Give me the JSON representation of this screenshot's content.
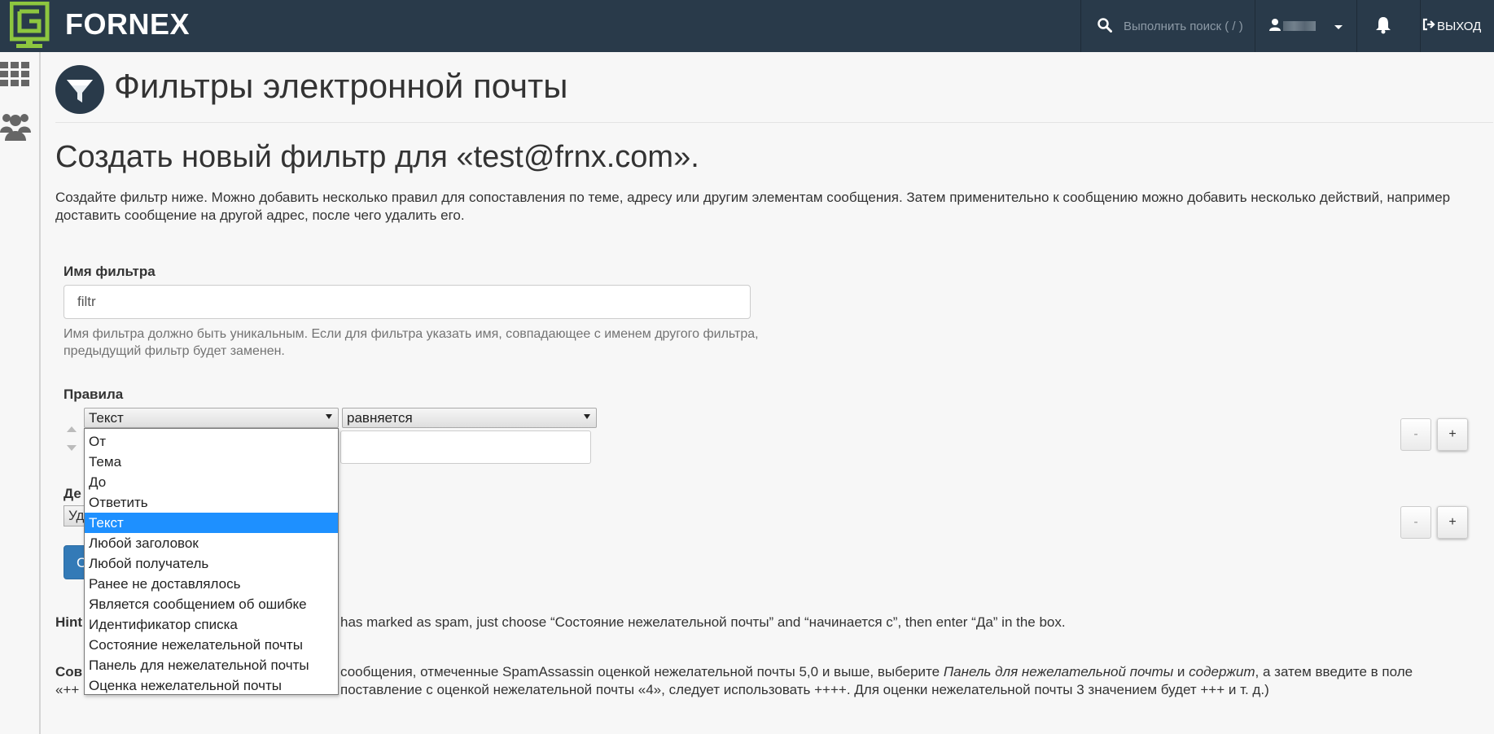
{
  "brand": {
    "name": "FORNEX",
    "color": "#8dc63f",
    "bar_color": "#293a4a"
  },
  "topbar": {
    "search_placeholder": "Выполнить поиск ( / )",
    "logout_label": "ВЫХОД",
    "icons": {
      "search": "search-icon",
      "user": "user-icon",
      "caret": "chevron-down-icon",
      "bell": "bell-icon",
      "logout": "logout-icon"
    }
  },
  "page": {
    "title": "Фильтры электронной почты",
    "create_heading": "Создать новый фильтр для «test@frnx.com».",
    "intro": "Создайте фильтр ниже. Можно добавить несколько правил для сопоставления по теме, адресу или другим элементам сообщения. Затем применительно к сообщению можно добавить несколько действий, например доставить сообщение на другой адрес, после чего удалить его."
  },
  "form": {
    "filter_name_label": "Имя фильтра",
    "filter_name_value": "filtr",
    "filter_name_help": "Имя фильтра должно быть уникальным. Если для фильтра указать имя, совпадающее с именем другого фильтра, предыдущий фильтр будет заменен.",
    "rules_label": "Правила",
    "rule_field_value": "Текст",
    "rule_operator_value": "равняется",
    "actions_label": "Де",
    "action_value": "Уд",
    "create_button": "С",
    "minus_label": "-",
    "plus_label": "+"
  },
  "dropdown": {
    "options": [
      "От",
      "Тема",
      "До",
      "Ответить",
      "Текст",
      "Любой заголовок",
      "Любой получатель",
      "Ранее не доставлялось",
      "Является сообщением об ошибке",
      "Идентификатор списка",
      "Состояние нежелательной почты",
      "Панель для нежелательной почты",
      "Оценка нежелательной почты"
    ],
    "selected_index": 4,
    "highlight_color": "#1e90ff"
  },
  "hint": {
    "label": "Hint",
    "rest": "has marked as spam, just choose “Состояние нежелательной почты” and “начинается с”, then enter “Да” in the box."
  },
  "tip": {
    "label": "Сов",
    "l1_a": "сообщения, отмеченные SpamAssassin оценкой нежелательной почты 5,0 и выше, выберите ",
    "l1_i1": "Панель для нежелательной почты",
    "l1_b": " и ",
    "l1_i2": "содержит",
    "l1_c": ", а затем введите в поле",
    "l2_a": "«++",
    "l2_b": "поставление с оценкой нежелательной почты «4», следует использовать ++++. Для оценки нежелательной почты 3 значением будет +++ и т. д.)"
  }
}
